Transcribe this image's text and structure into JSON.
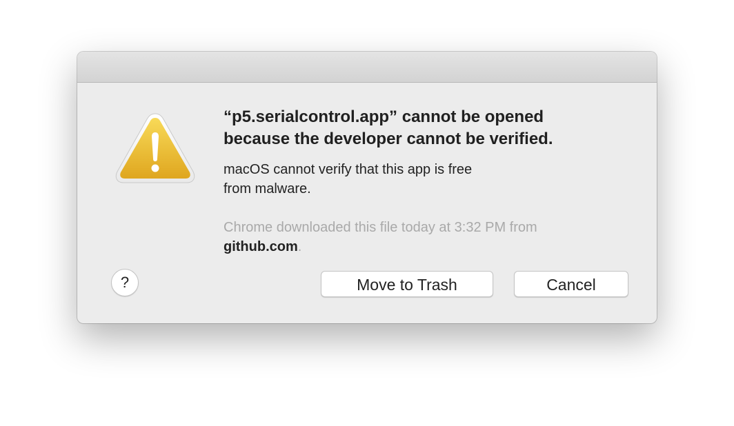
{
  "dialog": {
    "icon": "warning-triangle-icon",
    "title": "“p5.serialcontrol.app” cannot be opened\nbecause the developer cannot be verified.",
    "message": "macOS cannot verify that this app is free\nfrom malware.",
    "source_prefix": "Chrome downloaded this file today at 3:32 PM from",
    "source_domain": "github.com",
    "source_suffix": ".",
    "help_label": "?",
    "buttons": {
      "move_to_trash": "Move to Trash",
      "cancel": "Cancel"
    }
  },
  "colors": {
    "dialog_background": "#ececec",
    "warning_yellow": "#e5b52c",
    "secondary_text": "#a9a9a9"
  }
}
